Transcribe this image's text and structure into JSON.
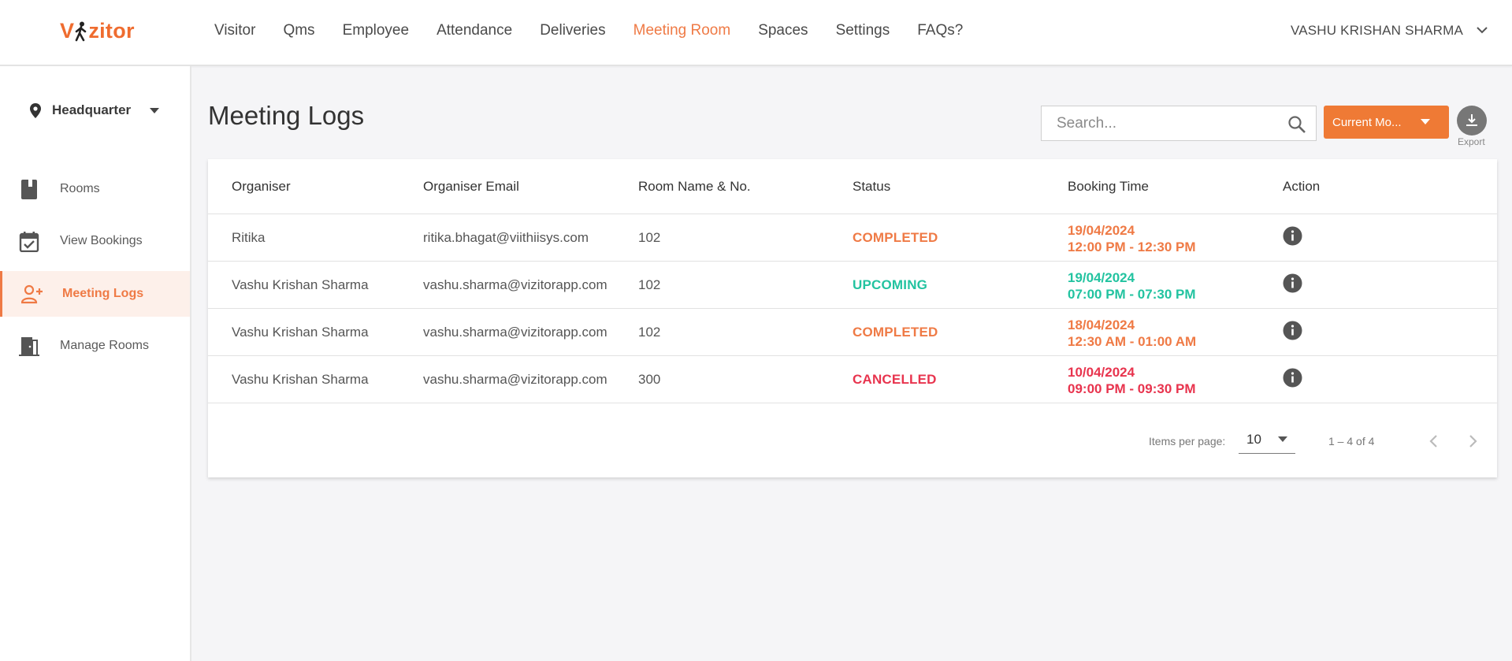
{
  "brand": {
    "logo_text_left": "V",
    "logo_text_right": "zitor",
    "color": "#ef6c2f"
  },
  "nav": {
    "items": [
      {
        "label": "Visitor",
        "active": false
      },
      {
        "label": "Qms",
        "active": false
      },
      {
        "label": "Employee",
        "active": false
      },
      {
        "label": "Attendance",
        "active": false
      },
      {
        "label": "Deliveries",
        "active": false
      },
      {
        "label": "Meeting Room",
        "active": true
      },
      {
        "label": "Spaces",
        "active": false
      },
      {
        "label": "Settings",
        "active": false
      },
      {
        "label": "FAQs?",
        "active": false
      }
    ],
    "user_name": "VASHU KRISHAN SHARMA"
  },
  "sidebar": {
    "location": "Headquarter",
    "items": [
      {
        "label": "Rooms",
        "icon": "book-icon",
        "active": false
      },
      {
        "label": "View Bookings",
        "icon": "calendar-check-icon",
        "active": false
      },
      {
        "label": "Meeting Logs",
        "icon": "user-add-icon",
        "active": true
      },
      {
        "label": "Manage Rooms",
        "icon": "door-icon",
        "active": false
      }
    ]
  },
  "main": {
    "title": "Meeting Logs",
    "search_placeholder": "Search...",
    "period_label": "Current Mo...",
    "export_label": "Export"
  },
  "table": {
    "headers": [
      "Organiser",
      "Organiser Email",
      "Room Name & No.",
      "Status",
      "Booking Time",
      "Action"
    ],
    "rows": [
      {
        "organiser": "Ritika",
        "email": "ritika.bhagat@viithiisys.com",
        "room": "102",
        "status": "COMPLETED",
        "date": "19/04/2024",
        "time": "12:00 PM - 12:30 PM"
      },
      {
        "organiser": "Vashu Krishan Sharma",
        "email": "vashu.sharma@vizitorapp.com",
        "room": "102",
        "status": "UPCOMING",
        "date": "19/04/2024",
        "time": "07:00 PM - 07:30 PM"
      },
      {
        "organiser": "Vashu Krishan Sharma",
        "email": "vashu.sharma@vizitorapp.com",
        "room": "102",
        "status": "COMPLETED",
        "date": "18/04/2024",
        "time": "12:30 AM - 01:00 AM"
      },
      {
        "organiser": "Vashu Krishan Sharma",
        "email": "vashu.sharma@vizitorapp.com",
        "room": "300",
        "status": "CANCELLED",
        "date": "10/04/2024",
        "time": "09:00 PM - 09:30 PM"
      }
    ]
  },
  "status_colors": {
    "COMPLETED": "#ef7a45",
    "UPCOMING": "#22c3a0",
    "CANCELLED": "#e8344e"
  },
  "paginator": {
    "items_per_page_label": "Items per page:",
    "items_per_page_value": "10",
    "range_label": "1 – 4 of 4"
  }
}
